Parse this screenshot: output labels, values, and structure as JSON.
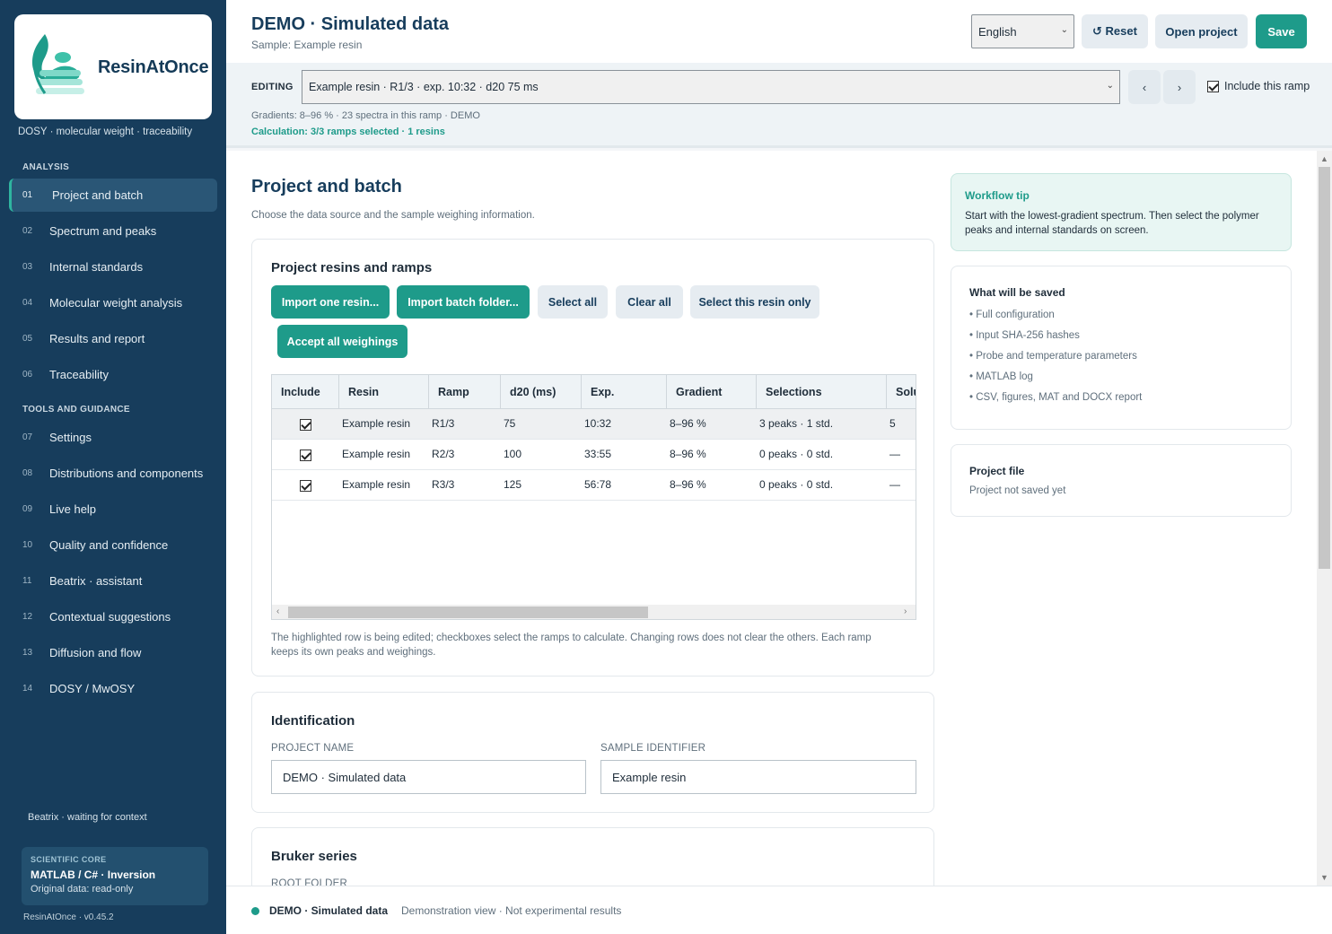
{
  "brand": {
    "name": "ResinAtOnce",
    "tagline": "DOSY · molecular weight · traceability",
    "accent": "#1e9b8a",
    "sidebar_bg": "#173d5c"
  },
  "sidebar": {
    "analysis_label": "ANALYSIS",
    "tools_label": "TOOLS AND GUIDANCE",
    "items": [
      {
        "num": "01",
        "label": "Project and batch",
        "active": true
      },
      {
        "num": "02",
        "label": "Spectrum and peaks"
      },
      {
        "num": "03",
        "label": "Internal standards"
      },
      {
        "num": "04",
        "label": "Molecular weight analysis"
      },
      {
        "num": "05",
        "label": "Results and report"
      },
      {
        "num": "06",
        "label": "Traceability"
      },
      {
        "num": "07",
        "label": "Settings"
      },
      {
        "num": "08",
        "label": "Distributions and components"
      },
      {
        "num": "09",
        "label": "Live help"
      },
      {
        "num": "10",
        "label": "Quality and confidence"
      },
      {
        "num": "11",
        "label": "Beatrix · assistant"
      },
      {
        "num": "12",
        "label": "Contextual suggestions"
      },
      {
        "num": "13",
        "label": "Diffusion and flow"
      },
      {
        "num": "14",
        "label": "DOSY / MwOSY"
      }
    ],
    "beatrix_status": "Beatrix · waiting for context",
    "core": {
      "title": "SCIENTIFIC CORE",
      "main": "MATLAB / C# · Inversion",
      "sub": "Original data: read-only"
    },
    "version": "ResinAtOnce · v0.45.2"
  },
  "header": {
    "title": "DEMO · Simulated data",
    "subtitle": "Sample: Example resin",
    "language": "English",
    "reset_label": "↺ Reset",
    "open_label": "Open project",
    "save_label": "Save"
  },
  "editbar": {
    "label": "EDITING",
    "selected_ramp": "Example resin · R1/3 · exp. 10:32 · d20 75 ms",
    "prev": "‹",
    "next": "›",
    "include_label": "Include this ramp",
    "include_checked": true,
    "gradients_info": "Gradients: 8–96 % · 23 spectra in this ramp · DEMO",
    "calc_info": "Calculation: 3/3 ramps selected · 1 resins"
  },
  "main": {
    "title": "Project and batch",
    "description": "Choose the data source and the sample weighing information.",
    "resins": {
      "title": "Project resins and ramps",
      "buttons": {
        "import_one": "Import one resin...",
        "import_batch": "Import batch folder...",
        "select_all": "Select all",
        "clear_all": "Clear all",
        "select_this": "Select this resin only",
        "accept_weighings": "Accept all weighings"
      },
      "columns": [
        "Include",
        "Resin",
        "Ramp",
        "d20 (ms)",
        "Exp.",
        "Gradient",
        "Selections",
        "Solu"
      ],
      "rows": [
        {
          "include": true,
          "resin": "Example resin",
          "ramp": "R1/3",
          "d20": "75",
          "exp": "10:32",
          "gradient": "8–96 %",
          "selections": "3 peaks · 1 std.",
          "solu": "5"
        },
        {
          "include": true,
          "resin": "Example resin",
          "ramp": "R2/3",
          "d20": "100",
          "exp": "33:55",
          "gradient": "8–96 %",
          "selections": "0 peaks · 0 std.",
          "solu": "—"
        },
        {
          "include": true,
          "resin": "Example resin",
          "ramp": "R3/3",
          "d20": "125",
          "exp": "56:78",
          "gradient": "8–96 %",
          "selections": "0 peaks · 0 std.",
          "solu": "—"
        }
      ],
      "note": "The highlighted row is being edited; checkboxes select the ramps to calculate. Changing rows does not clear the others. Each ramp keeps its own peaks and weighings."
    },
    "identification": {
      "title": "Identification",
      "project_name_label": "PROJECT NAME",
      "project_name_value": "DEMO · Simulated data",
      "sample_id_label": "SAMPLE IDENTIFIER",
      "sample_id_value": "Example resin"
    },
    "bruker": {
      "title": "Bruker series",
      "root_folder_label": "ROOT FOLDER"
    }
  },
  "aside": {
    "tip": {
      "title": "Workflow tip",
      "text": "Start with the lowest-gradient spectrum. Then select the polymer peaks and internal standards on screen."
    },
    "saved": {
      "title": "What will be saved",
      "items": [
        "• Full configuration",
        "• Input SHA-256 hashes",
        "• Probe and temperature parameters",
        "• MATLAB log",
        "• CSV, figures, MAT and DOCX report"
      ]
    },
    "project_file": {
      "title": "Project file",
      "status": "Project not saved yet"
    }
  },
  "footer": {
    "title": "DEMO · Simulated data",
    "note": "Demonstration view · Not experimental results"
  }
}
